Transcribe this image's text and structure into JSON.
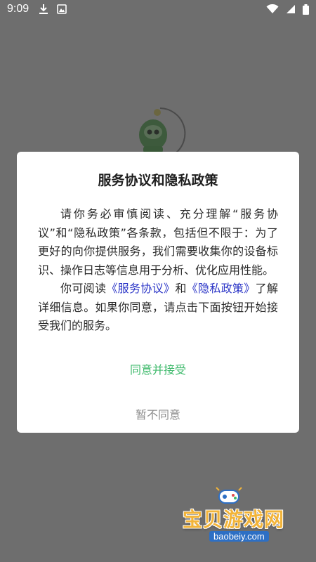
{
  "status_bar": {
    "time": "9:09",
    "left_icons": [
      "download-icon",
      "image-notification-icon"
    ],
    "right_icons": [
      "wifi-icon",
      "signal-icon",
      "battery-icon"
    ]
  },
  "dialog": {
    "title": "服务协议和隐私政策",
    "paragraph1": "请你务必审慎阅读、充分理解“服务协议”和“隐私政策”各条款，包括但不限于：为了更好的向你提供服务，我们需要收集你的设备标识、操作日志等信息用于分析、优化应用性能。",
    "paragraph2_prefix": "你可阅读",
    "service_link": "《服务协议》",
    "paragraph2_and": "和",
    "privacy_link": "《隐私政策》",
    "paragraph2_suffix": "了解详细信息。如果你同意，请点击下面按钮开始接受我们的服务。",
    "accept_label": "同意并接受",
    "decline_label": "暂不同意"
  },
  "watermark": {
    "text": "宝贝游戏网",
    "url": "baobeiy.com"
  },
  "colors": {
    "overlay_background": "#6e6e6e",
    "link": "#2b35c7",
    "accept": "#3cb96a",
    "decline": "#8c8c8c"
  }
}
